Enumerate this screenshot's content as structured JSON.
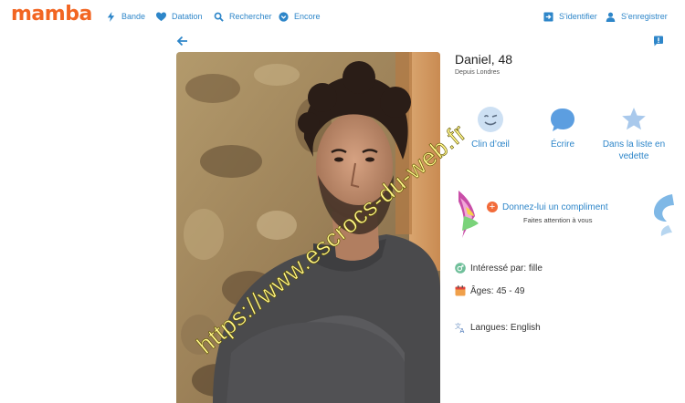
{
  "header": {
    "logo": "mamba",
    "nav": [
      {
        "label": "Bande",
        "icon": "lightning-icon"
      },
      {
        "label": "Datation",
        "icon": "heart-icon"
      },
      {
        "label": "Rechercher",
        "icon": "search-icon"
      },
      {
        "label": "Encore",
        "icon": "chevron-down-circle-icon"
      }
    ],
    "login_label": "S'identifier",
    "register_label": "S'enregistrer"
  },
  "profile": {
    "name": "Daniel, 48",
    "location": "Depuis Londres",
    "photo_watermark": "https://www.escrocs-du-web.fr"
  },
  "actions": {
    "wink_label": "Clin d’œil",
    "write_label": "Écrire",
    "featured_label": "Dans la liste en vedette"
  },
  "compliment": {
    "button_label": "Donnez-lui un compliment",
    "subtitle": "Faites attention à vous"
  },
  "details": {
    "interested": "Intéressé par: fille",
    "ages": "Âges: 45 - 49",
    "languages": "Langues: English"
  },
  "colors": {
    "brand": "#f26522",
    "link": "#2e86c9"
  }
}
